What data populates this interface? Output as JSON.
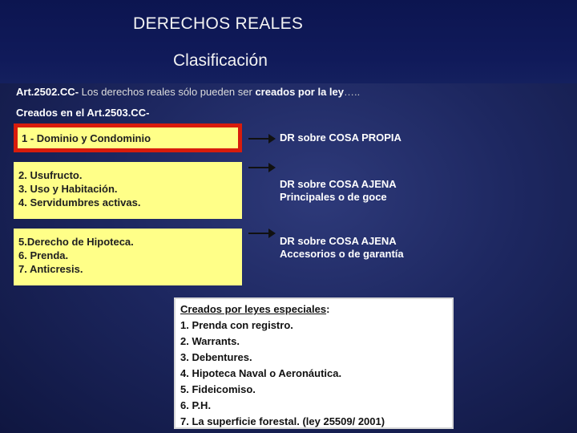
{
  "header": {
    "title": "DERECHOS REALES",
    "subtitle": "Clasificación"
  },
  "intro": {
    "article_ref": "Art.2502.CC-",
    "text": " Los derechos reales sólo pueden ser ",
    "emphasis": "creados por la ley",
    "ellipsis": "…..",
    "created_in": "Creados en el Art.2503.CC-"
  },
  "rows": [
    {
      "items": [
        "1 - Dominio y Condominio"
      ],
      "dr_lines": [
        "DR sobre COSA PROPIA"
      ]
    },
    {
      "items": [
        "2. Usufructo.",
        "3. Uso y Habitación.",
        "4. Servidumbres activas."
      ],
      "dr_lines": [
        "DR sobre COSA AJENA",
        "Principales o de goce"
      ]
    },
    {
      "items": [
        "5.Derecho de Hipoteca.",
        "6. Prenda.",
        "7. Anticresis."
      ],
      "dr_lines": [
        "DR sobre COSA AJENA",
        "Accesorios o de garantía"
      ]
    }
  ],
  "special": {
    "heading": "Creados por leyes especiales",
    "colon": ":",
    "items": [
      "1. Prenda con registro.",
      "2. Warrants.",
      "3. Debentures.",
      "4. Hipoteca Naval o Aeronáutica.",
      "5. Fideicomiso.",
      "6. P.H.",
      "7. La superficie forestal. (ley 25509/ 2001)"
    ]
  },
  "colors": {
    "background": "#1d2760",
    "box_fill": "#ffff88",
    "highlight_border": "#d81c0c"
  }
}
